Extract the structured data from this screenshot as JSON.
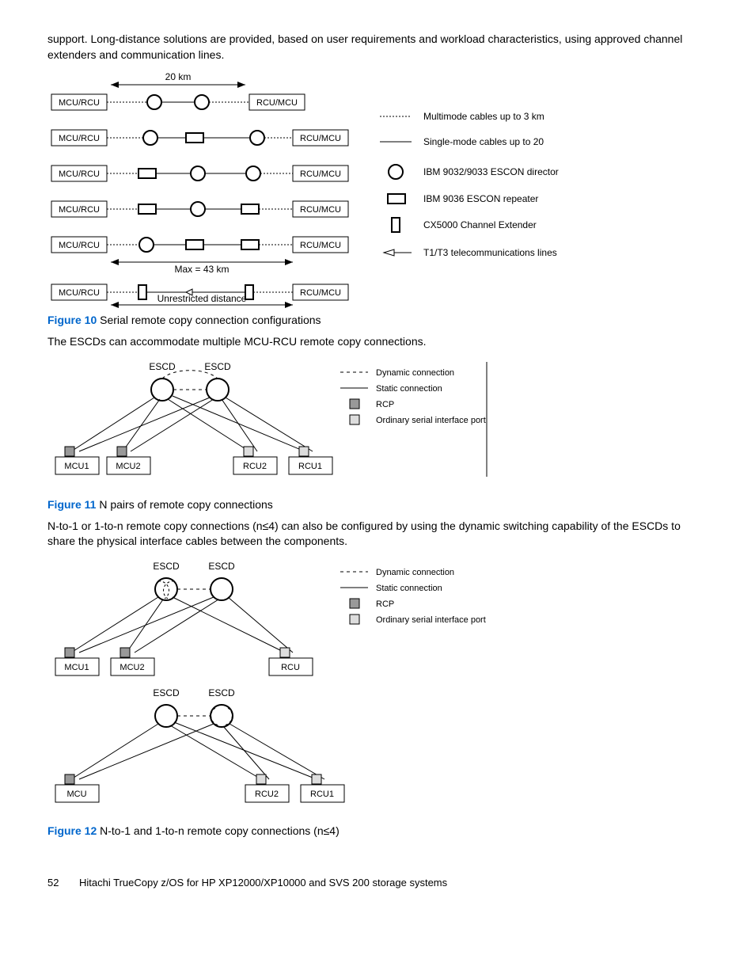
{
  "intro": "support. Long-distance solutions are provided, based on user requirements and workload characteristics, using approved channel extenders and communication lines.",
  "fig10": {
    "label": "Figure 10",
    "title": "Serial remote copy connection configurations",
    "dist_top": "20 km",
    "dist_mid": "Max = 43 km",
    "dist_bot": "Unrestricted distance",
    "leftbox": "MCU/RCU",
    "rightbox": "RCU/MCU",
    "legend": {
      "multimode": "Multimode cables up to 3 km",
      "singlemode": "Single-mode cables up to 20",
      "director": "IBM 9032/9033 ESCON director",
      "repeater": "IBM 9036 ESCON repeater",
      "extender": "CX5000 Channel Extender",
      "telecom": "T1/T3 telecommunications lines"
    }
  },
  "after_fig10": "The ESCDs can accommodate multiple MCU-RCU remote copy connections.",
  "fig11": {
    "label": "Figure 11",
    "title": "N pairs of remote copy connections",
    "escd": "ESCD",
    "mcu1": "MCU1",
    "mcu2": "MCU2",
    "rcu2": "RCU2",
    "rcu1": "RCU1",
    "legend": {
      "dynamic": "Dynamic connection",
      "static": "Static connection",
      "rcp": "RCP",
      "ordinary": "Ordinary serial interface port"
    }
  },
  "after_fig11": "N-to-1 or 1-to-n remote copy connections (n≤4) can also be configured by using the dynamic switching capability of the ESCDs to share the physical interface cables between the components.",
  "fig12": {
    "label": "Figure 12",
    "title": "N-to-1 and 1-to-n remote copy connections (n≤4)",
    "escd": "ESCD",
    "mcu": "MCU",
    "mcu1": "MCU1",
    "mcu2": "MCU2",
    "rcu": "RCU",
    "rcu2": "RCU2",
    "rcu1": "RCU1",
    "legend": {
      "dynamic": "Dynamic connection",
      "static": "Static connection",
      "rcp": "RCP",
      "ordinary": "Ordinary serial interface port"
    }
  },
  "footer": {
    "page": "52",
    "doc": "Hitachi TrueCopy z/OS for HP XP12000/XP10000 and SVS 200 storage systems"
  }
}
